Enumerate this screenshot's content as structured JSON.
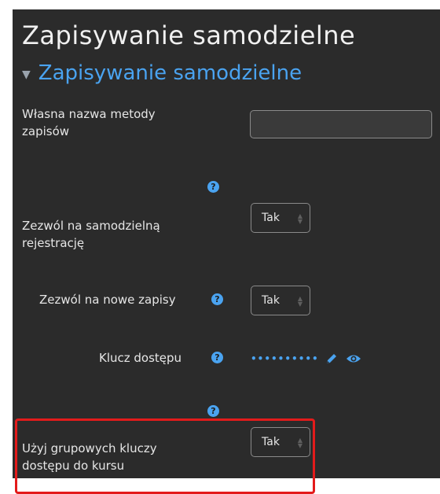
{
  "page": {
    "title": "Zapisywanie samodzielne"
  },
  "section": {
    "title": "Zapisywanie samodzielne",
    "caret_icon": "caret-down-icon"
  },
  "form": {
    "custom_name": {
      "label": "Własna nazwa metody zapisów",
      "value": ""
    },
    "allow_self_enrol": {
      "label": "Zezwól na samodzielną rejestrację",
      "value": "Tak"
    },
    "allow_new_enrols": {
      "label": "Zezwól na nowe zapisy",
      "value": "Tak"
    },
    "enrolment_key": {
      "label": "Klucz dostępu",
      "masked_value": "••••••••••",
      "edit_icon": "pencil-icon",
      "reveal_icon": "eye-icon"
    },
    "group_keys": {
      "label": "Użyj grupowych kluczy dostępu do kursu",
      "value": "Tak"
    }
  },
  "help_icon": "question-circle-icon",
  "colors": {
    "background": "#2b2b2b",
    "accent": "#4aa3f0",
    "highlight": "#e31b1b"
  }
}
